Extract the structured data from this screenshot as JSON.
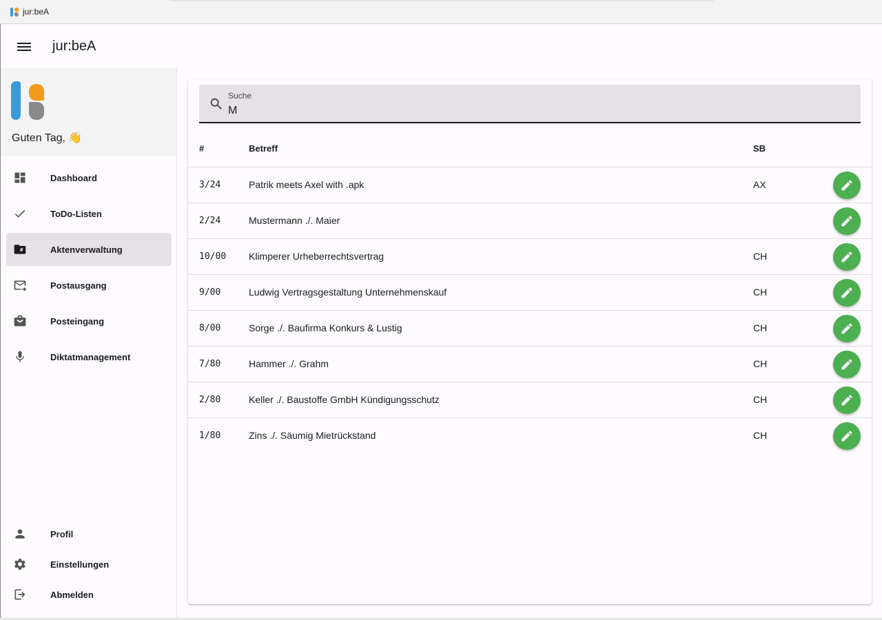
{
  "window": {
    "title": "jur:beA"
  },
  "appbar": {
    "title": "jur:beA"
  },
  "sidebar": {
    "greeting": "Guten Tag, 👋",
    "items": [
      {
        "label": "Dashboard",
        "icon": "dashboard-icon"
      },
      {
        "label": "ToDo-Listen",
        "icon": "check-icon"
      },
      {
        "label": "Aktenverwaltung",
        "icon": "folder-hash-icon",
        "active": true
      },
      {
        "label": "Postausgang",
        "icon": "mail-outgoing-icon"
      },
      {
        "label": "Posteingang",
        "icon": "inbox-icon"
      },
      {
        "label": "Diktatmanagement",
        "icon": "microphone-icon"
      }
    ],
    "bottom_items": [
      {
        "label": "Profil",
        "icon": "person-icon"
      },
      {
        "label": "Einstellungen",
        "icon": "gear-icon"
      },
      {
        "label": "Abmelden",
        "icon": "logout-icon"
      }
    ]
  },
  "search": {
    "label": "Suche",
    "value": "M"
  },
  "table": {
    "headers": {
      "num": "#",
      "subject": "Betreff",
      "sb": "SB"
    },
    "rows": [
      {
        "num": "3/24",
        "subject": "Patrik meets Axel with .apk",
        "sb": "AX"
      },
      {
        "num": "2/24",
        "subject": "Mustermann ./. Maier",
        "sb": ""
      },
      {
        "num": "10/00",
        "subject": "Klimperer Urheberrechtsvertrag",
        "sb": "CH"
      },
      {
        "num": "9/00",
        "subject": "Ludwig Vertragsgestaltung Unternehmenskauf",
        "sb": "CH"
      },
      {
        "num": "8/00",
        "subject": "Sorge ./. Baufirma Konkurs & Lustig",
        "sb": "CH"
      },
      {
        "num": "7/80",
        "subject": "Hammer ./. Grahm",
        "sb": "CH"
      },
      {
        "num": "2/80",
        "subject": "Keller ./. Baustoffe GmbH Kündigungsschutz",
        "sb": "CH"
      },
      {
        "num": "1/80",
        "subject": "Zins ./. Säumig Mietrückstand",
        "sb": "CH"
      }
    ]
  },
  "colors": {
    "accent_green": "#4caf50",
    "active_nav_bg": "#e6e1e5",
    "search_bg": "#e6e1e5"
  }
}
